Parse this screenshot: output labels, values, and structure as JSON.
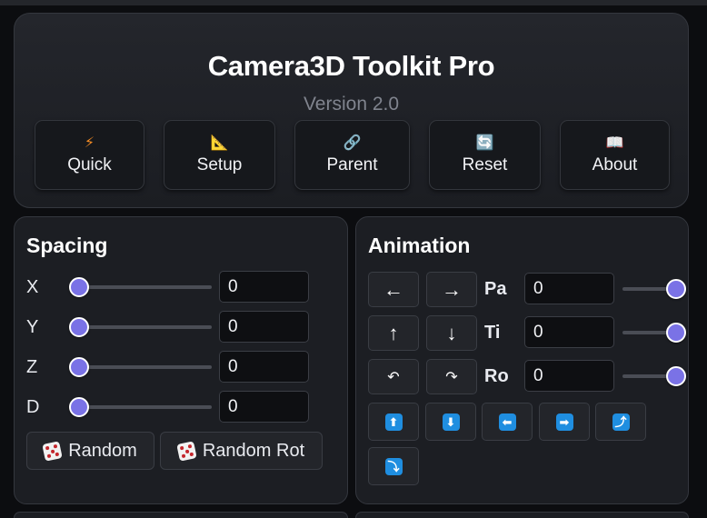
{
  "header": {
    "title": "Camera3D Toolkit Pro",
    "version": "Version 2.0",
    "nav": [
      {
        "label": "Quick",
        "icon": "lightning-icon",
        "glyph": "⚡"
      },
      {
        "label": "Setup",
        "icon": "ruler-icon",
        "glyph": "📐"
      },
      {
        "label": "Parent",
        "icon": "link-icon",
        "glyph": "🔗"
      },
      {
        "label": "Reset",
        "icon": "refresh-icon",
        "glyph": "🔄"
      },
      {
        "label": "About",
        "icon": "book-icon",
        "glyph": "📖"
      }
    ]
  },
  "spacing": {
    "title": "Spacing",
    "rows": [
      {
        "label": "X",
        "value": "0",
        "slider_fraction": 0
      },
      {
        "label": "Y",
        "value": "0",
        "slider_fraction": 0
      },
      {
        "label": "Z",
        "value": "0",
        "slider_fraction": 0
      },
      {
        "label": "D",
        "value": "0",
        "slider_fraction": 0
      }
    ],
    "random_label": "Random",
    "random_rot_label": "Random Rot"
  },
  "animation": {
    "title": "Animation",
    "arrows": [
      "←",
      "→",
      "↑",
      "↓",
      "↶",
      "↷"
    ],
    "rows": [
      {
        "label": "Pa",
        "value": "0",
        "slider_fraction": 1
      },
      {
        "label": "Ti",
        "value": "0",
        "slider_fraction": 1
      },
      {
        "label": "Ro",
        "value": "0",
        "slider_fraction": 1
      }
    ],
    "quick_buttons": [
      {
        "icon": "arrow-up-icon",
        "glyph": "⬆"
      },
      {
        "icon": "arrow-down-icon",
        "glyph": "⬇"
      },
      {
        "icon": "arrow-left-icon",
        "glyph": "⬅"
      },
      {
        "icon": "arrow-right-icon",
        "glyph": "➡"
      },
      {
        "icon": "arrow-curve-up-icon",
        "glyph": "⤴"
      },
      {
        "icon": "arrow-curve-down-icon",
        "glyph": "⤵"
      }
    ]
  },
  "colors": {
    "accent": "#7a72e6",
    "panel": "#1c1e23",
    "background": "#0c0d10",
    "blue_icon": "#1f8ee0"
  }
}
